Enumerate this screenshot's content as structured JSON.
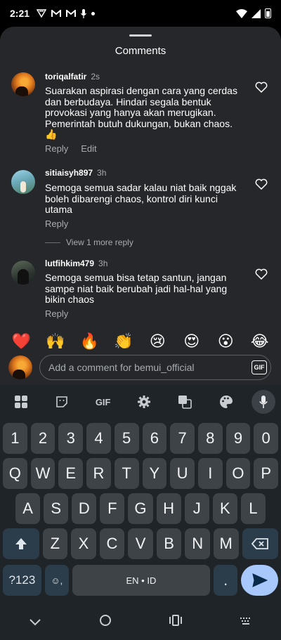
{
  "status_bar": {
    "time": "2:21",
    "left_icons": [
      "vpn-icon",
      "gmail-icon",
      "gmail-icon",
      "mic-icon",
      "dot-icon"
    ],
    "right_icons": [
      "wifi-icon",
      "signal-icon",
      "battery-icon"
    ]
  },
  "sheet": {
    "title": "Comments"
  },
  "comments": [
    {
      "user": "toriqalfatir",
      "time": "2s",
      "text": "Suarakan aspirasi dengan cara yang cerdas dan berbudaya. Hindari segala bentuk provokasi yang hanya akan merugikan. Pemerintah butuh dukungan, bukan chaos. 👍",
      "reply_label": "Reply",
      "edit_label": "Edit"
    },
    {
      "user": "sitiaisyh897",
      "time": "3h",
      "text": "Semoga semua sadar kalau niat baik nggak boleh dibarengi chaos, kontrol diri kunci utama",
      "reply_label": "Reply",
      "view_more": "View 1 more reply"
    },
    {
      "user": "lutfihkim479",
      "time": "3h",
      "text": "Semoga semua bisa tetap santun, jangan sampe niat baik berubah jadi hal-hal yang bikin chaos",
      "reply_label": "Reply"
    }
  ],
  "emojis": [
    "❤️",
    "🙌",
    "🔥",
    "👏",
    "😢",
    "😍",
    "😮",
    "😂"
  ],
  "compose": {
    "placeholder": "Add a comment for bemui_official",
    "gif_label": "GIF"
  },
  "keyboard": {
    "toolbar": {
      "gif_label": "GIF",
      "icons": [
        "apps-icon",
        "sticker-icon",
        "gif-icon",
        "settings-icon",
        "translate-icon",
        "palette-icon",
        "mic-icon"
      ]
    },
    "number_row": [
      "1",
      "2",
      "3",
      "4",
      "5",
      "6",
      "7",
      "8",
      "9",
      "0"
    ],
    "row1": [
      "Q",
      "W",
      "E",
      "R",
      "T",
      "Y",
      "U",
      "I",
      "O",
      "P"
    ],
    "row2": [
      "A",
      "S",
      "D",
      "F",
      "G",
      "H",
      "J",
      "K",
      "L"
    ],
    "row3": [
      "Z",
      "X",
      "C",
      "V",
      "B",
      "N",
      "M"
    ],
    "symbols_label": "?123",
    "emoji_key": "☺,",
    "space_label": "EN • ID",
    "period": "."
  },
  "nav": {
    "icons": [
      "back-chevron-icon",
      "home-circle-icon",
      "recents-icon",
      "keyboard-switch-icon"
    ]
  }
}
